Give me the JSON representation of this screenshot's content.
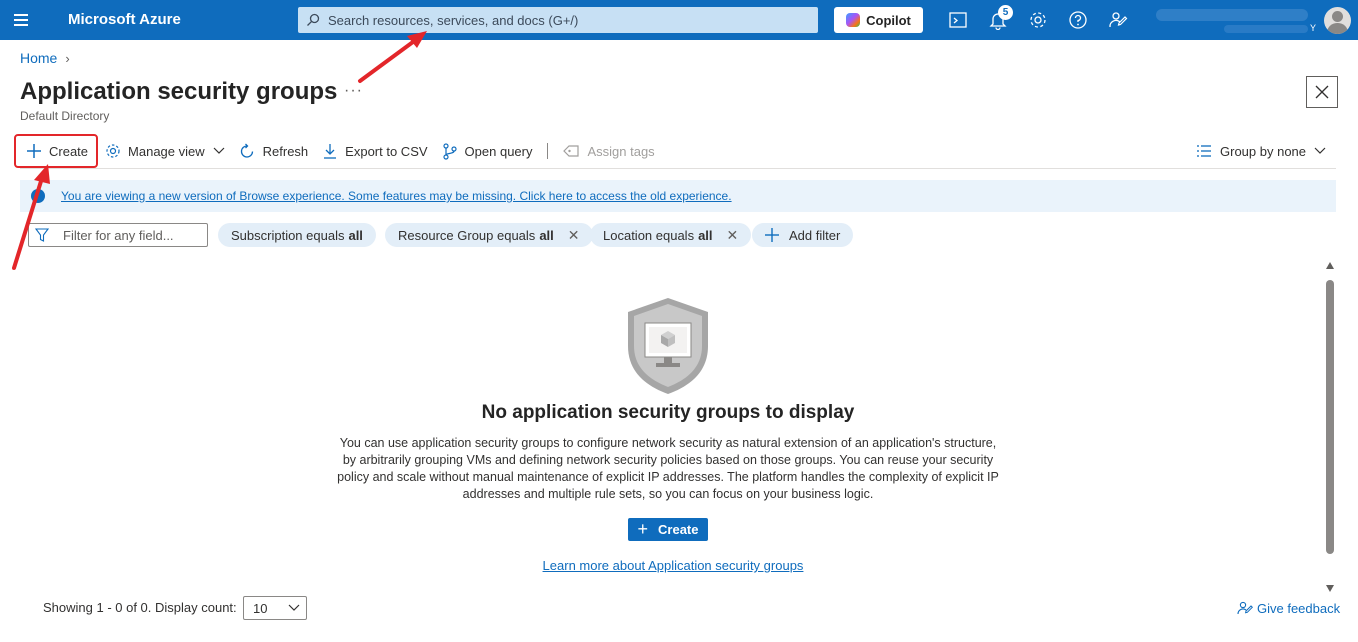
{
  "topbar": {
    "brand": "Microsoft Azure",
    "search_placeholder": "Search resources, services, and docs (G+/)",
    "copilot_label": "Copilot",
    "notification_count": "5",
    "account_initial": "Y",
    "color": "#0f6cbd"
  },
  "breadcrumb": {
    "home": "Home"
  },
  "page": {
    "title": "Application security groups",
    "more": "···",
    "subtitle": "Default Directory"
  },
  "toolbar": {
    "create": "Create",
    "manage_view": "Manage view",
    "refresh": "Refresh",
    "export_csv": "Export to CSV",
    "open_query": "Open query",
    "assign_tags": "Assign tags",
    "group_by": "Group by none"
  },
  "banner": {
    "text": "You are viewing a new version of Browse experience. Some features may be missing. Click here to access the old experience."
  },
  "filters": {
    "placeholder": "Filter for any field...",
    "subscription": {
      "label": "Subscription equals",
      "value": "all"
    },
    "resource_group": {
      "label": "Resource Group equals",
      "value": "all"
    },
    "location": {
      "label": "Location equals",
      "value": "all"
    },
    "add_filter": "Add filter"
  },
  "empty_state": {
    "title": "No application security groups to display",
    "description": "You can use application security groups to configure network security as natural extension of an application's structure, by arbitrarily grouping VMs and defining network security policies based on those groups. You can reuse your security policy and scale without manual maintenance of explicit IP addresses. The platform handles the complexity of explicit IP addresses and multiple rule sets, so you can focus on your business logic.",
    "create_button": "Create",
    "learn_more": "Learn more about Application security groups"
  },
  "footer": {
    "showing": "Showing 1 - 0 of 0. Display count:",
    "display_count": "10",
    "feedback": "Give feedback"
  }
}
